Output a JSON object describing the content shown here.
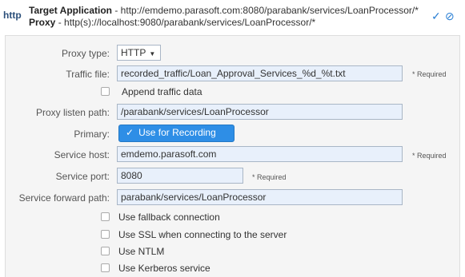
{
  "header": {
    "protocol": "http",
    "target_label": "Target Application",
    "target_value": " - http://emdemo.parasoft.com:8080/parabank/services/LoanProcessor/*",
    "proxy_label": "Proxy",
    "proxy_value": " - http(s)://localhost:9080/parabank/services/LoanProcessor/*",
    "icons": [
      "check-icon",
      "disable-icon"
    ]
  },
  "form": {
    "proxy_type": {
      "label": "Proxy type:",
      "value": "HTTP"
    },
    "traffic_file": {
      "label": "Traffic file:",
      "value": "recorded_traffic/Loan_Approval_Services_%d_%t.txt",
      "required": "* Required"
    },
    "append_traffic": {
      "label": "Append traffic data",
      "checked": false
    },
    "proxy_listen_path": {
      "label": "Proxy listen path:",
      "value": "/parabank/services/LoanProcessor"
    },
    "primary": {
      "label": "Primary:",
      "button": "Use for Recording",
      "active": true
    },
    "service_host": {
      "label": "Service host:",
      "value": "emdemo.parasoft.com",
      "required": "* Required"
    },
    "service_port": {
      "label": "Service port:",
      "value": "8080",
      "required": "* Required"
    },
    "service_forward_path": {
      "label": "Service forward path:",
      "value": "parabank/services/LoanProcessor"
    },
    "options": [
      {
        "label": "Use fallback connection",
        "checked": false
      },
      {
        "label": "Use SSL when connecting to the server",
        "checked": false
      },
      {
        "label": "Use NTLM",
        "checked": false
      },
      {
        "label": "Use Kerberos service",
        "checked": false
      }
    ]
  },
  "colors": {
    "accent": "#2e8ee6",
    "input_bg": "#e8f0fb",
    "panel_bg": "#f5f5f5"
  }
}
